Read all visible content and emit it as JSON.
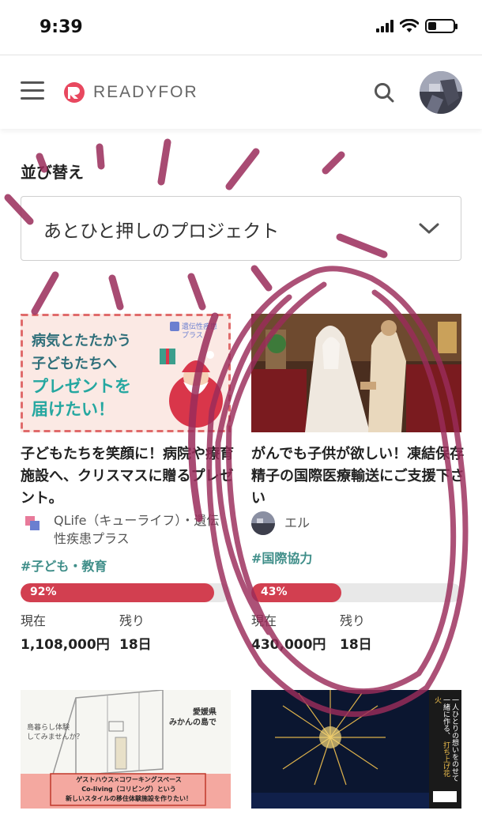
{
  "status_bar": {
    "time": "9:39"
  },
  "header": {
    "logo_text": "READYFOR",
    "brand_color": "#e8485f"
  },
  "sort": {
    "label": "並び替え",
    "selected": "あとひと押しのプロジェクト"
  },
  "projects": [
    {
      "thumb_text": [
        "病気とたたかう",
        "子どもたちへ",
        "プレゼントを",
        "届けたい！"
      ],
      "thumb_badge": [
        "遺伝性疾患",
        "プラス"
      ],
      "title": "子どもたちを笑顔に！病院や療育施設へ、クリスマスに贈るプレゼント。",
      "owner": "QLife（キューライフ）・遺伝性疾患プラス",
      "tag": "#子ども・教育",
      "progress_percent": 92,
      "progress_label": "92%",
      "current_label": "現在",
      "current_value": "1,108,000円",
      "remaining_label": "残り",
      "remaining_value": "18日"
    },
    {
      "title": "がんでも子供が欲しい！凍結保存精子の国際医療輸送にご支援下さい",
      "owner": "エル",
      "tag": "#国際協力",
      "progress_percent": 43,
      "progress_label": "43%",
      "current_label": "現在",
      "current_value": "430,000円",
      "remaining_label": "残り",
      "remaining_value": "18日"
    },
    {
      "thumb_text": [
        "愛媛県",
        "みかんの島で",
        "島暮らし体験",
        "してみませんか？"
      ],
      "thumb_banner": [
        "ゲストハウス×コワーキングスペース",
        "Co-living（コリビング）という",
        "新しいスタイルの移住体験施設を作りたい！"
      ]
    },
    {
      "thumb_text": [
        "一人ひとりの想いをのせて",
        "一緒に作る、",
        "打ち上げ花火"
      ]
    }
  ],
  "colors": {
    "accent": "#d23f50",
    "tag": "#3f8e89",
    "annotation": "#9a2c5a"
  }
}
